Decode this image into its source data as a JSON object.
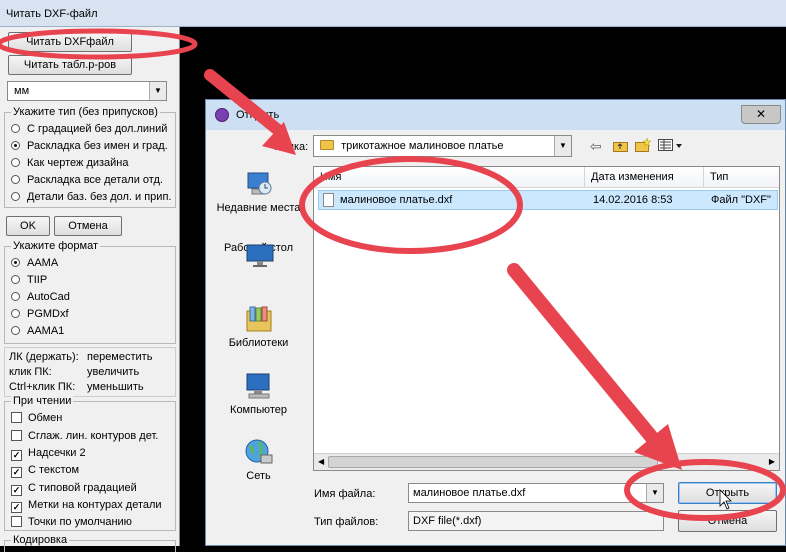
{
  "window": {
    "title": "Читать DXF-файл"
  },
  "panel": {
    "read_dxf_button": "Читать DXFфайл",
    "read_table_button": "Читать табл.р-ров",
    "units_value": "мм",
    "type_group": {
      "title": "Укажите тип (без припусков)",
      "options": [
        {
          "label": "С градацией без дол.линий",
          "selected": false
        },
        {
          "label": "Раскладка без имен и град.",
          "selected": true
        },
        {
          "label": "Как чертеж дизайна",
          "selected": false
        },
        {
          "label": "Раскладка все детали отд.",
          "selected": false
        },
        {
          "label": "Детали баз. без дол. и прип.",
          "selected": false
        }
      ]
    },
    "ok_button": "OK",
    "cancel_button": "Отмена",
    "format_group": {
      "title": "Укажите формат",
      "options": [
        {
          "label": "AAMA",
          "selected": true
        },
        {
          "label": "TIIP",
          "selected": false
        },
        {
          "label": "AutoCad",
          "selected": false
        },
        {
          "label": "PGMDxf",
          "selected": false
        },
        {
          "label": "AAMA1",
          "selected": false
        }
      ]
    },
    "hints": [
      {
        "key": "ЛК (держать):",
        "value": "переместить"
      },
      {
        "key": "клик ПК:",
        "value": "увеличить"
      },
      {
        "key": "Ctrl+клик ПК:",
        "value": "уменьшить"
      }
    ],
    "read_group": {
      "title": "При чтении",
      "options": [
        {
          "label": "Обмен",
          "checked": false
        },
        {
          "label": "Сглаж. лин. контуров дет.",
          "checked": false
        },
        {
          "label": "Надсечки 2",
          "checked": true
        },
        {
          "label": "С текстом",
          "checked": true
        },
        {
          "label": "С типовой градацией",
          "checked": true
        },
        {
          "label": "Метки на контурах детали",
          "checked": true
        },
        {
          "label": "Точки по умолчанию",
          "checked": false
        }
      ]
    },
    "encoding_title": "Кодировка"
  },
  "dialog": {
    "title": "Открыть",
    "close_glyph": "✕",
    "folder_label": "Папка:",
    "folder_value": "трикотажное малиновое платье",
    "places": [
      {
        "label": "Недавние места",
        "icon": "recent-places-icon"
      },
      {
        "label": "Рабочий стол",
        "icon": "desktop-icon"
      },
      {
        "label": "Библиотеки",
        "icon": "libraries-icon"
      },
      {
        "label": "Компьютер",
        "icon": "computer-icon"
      },
      {
        "label": "Сеть",
        "icon": "network-icon"
      }
    ],
    "columns": [
      "Имя",
      "Дата изменения",
      "Тип"
    ],
    "files": [
      {
        "name": "малиновое платье.dxf",
        "date": "14.02.2016 8:53",
        "type": "Файл \"DXF\""
      }
    ],
    "file_name_label": "Имя файла:",
    "file_name_value": "малиновое платье.dxf",
    "file_type_label": "Тип файлов:",
    "file_type_value": "DXF file(*.dxf)",
    "open_button": "Открыть",
    "cancel_button": "Отмена"
  },
  "colors": {
    "annotation": "#e8444f",
    "selection": "#cce8ff",
    "accent": "#3c7fc6"
  }
}
